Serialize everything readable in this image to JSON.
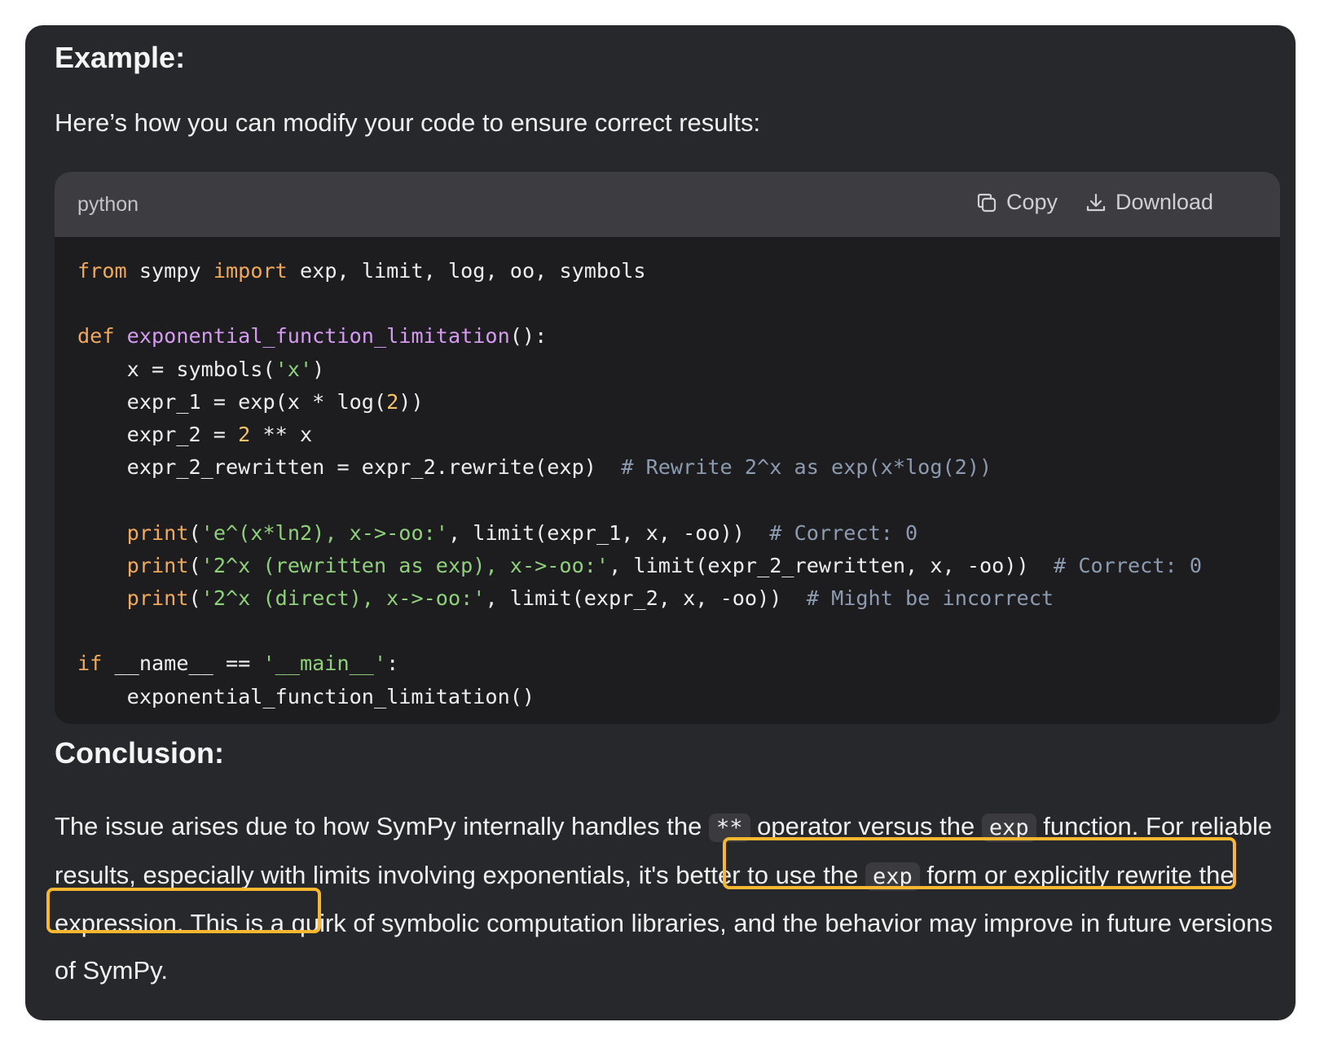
{
  "example_heading": "Example:",
  "intro": "Here’s how you can modify your code to ensure correct results:",
  "code_block": {
    "language": "python",
    "copy_label": "Copy",
    "download_label": "Download",
    "lines": [
      "from sympy import exp, limit, log, oo, symbols",
      "",
      "def exponential_function_limitation():",
      "    x = symbols('x')",
      "    expr_1 = exp(x * log(2))",
      "    expr_2 = 2 ** x",
      "    expr_2_rewritten = expr_2.rewrite(exp)  # Rewrite 2^x as exp(x*log(2))",
      "",
      "    print('e^(x*ln2), x->-oo:', limit(expr_1, x, -oo))  # Correct: 0",
      "    print('2^x (rewritten as exp), x->-oo:', limit(expr_2_rewritten, x, -oo))  # Correct: 0",
      "    print('2^x (direct), x->-oo:', limit(expr_2, x, -oo))  # Might be incorrect",
      "",
      "if __name__ == '__main__':",
      "    exponential_function_limitation()"
    ]
  },
  "conclusion_heading": "Conclusion:",
  "conclusion": {
    "part1": "The issue arises due to how SymPy internally handles the ",
    "code1": "**",
    "part2": " operator versus the ",
    "code2": "exp",
    "part3": " function. For reliable results, especially with limits involving exponentials",
    "part4": ", it's better to use the ",
    "code3": "exp",
    "part5": " form or explicitly rewrite the expression.",
    "part6": " This is a quirk of symbolic computation libraries, and the behavior may improve in future versions of SymPy."
  },
  "highlight_color": "#f7b731"
}
